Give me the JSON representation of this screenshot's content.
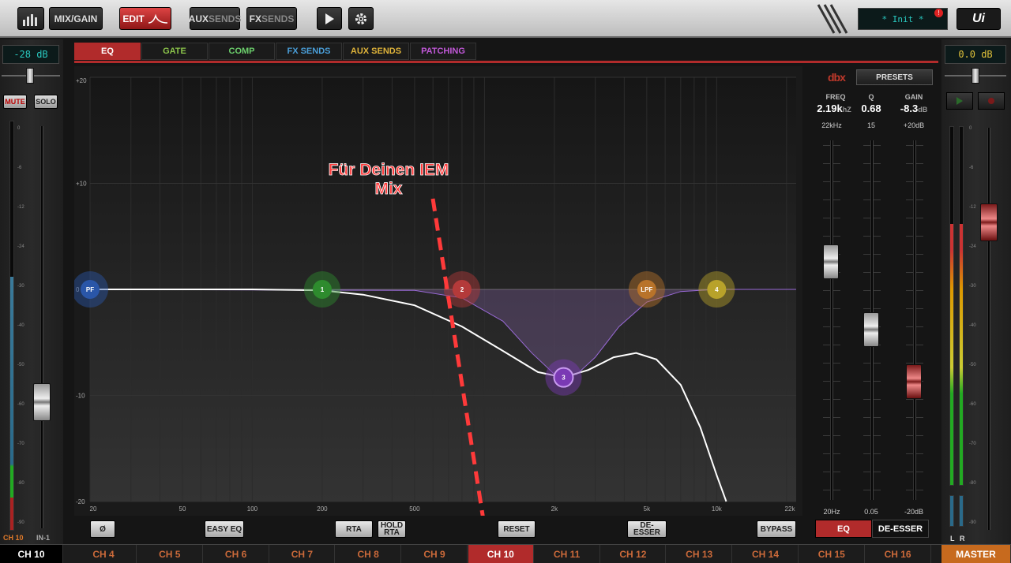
{
  "topbar": {
    "mix_gain": "MIX/GAIN",
    "edit": "EDIT",
    "aux_a": "AUX",
    "aux_b": "SENDS",
    "fx_a": "FX",
    "fx_b": "SENDS",
    "scene_display": "* Init *",
    "badge": "!",
    "logo": "Ui"
  },
  "left_strip": {
    "db": "-28 dB",
    "mute": "MUTE",
    "solo": "SOLO",
    "scale": [
      "0",
      "-6",
      "-12",
      "-24",
      "-30",
      "-40",
      "-50",
      "-60",
      "-70",
      "-80",
      "-90"
    ],
    "meter_scale": [
      "10",
      "15",
      "20"
    ],
    "label_left": "CH 10",
    "label_right": "IN-1"
  },
  "tabs": [
    {
      "label": "EQ",
      "color": "#ffffff"
    },
    {
      "label": "GATE",
      "color": "#8bc34a"
    },
    {
      "label": "COMP",
      "color": "#6ccf6c"
    },
    {
      "label": "FX SENDS",
      "color": "#4a9ed8"
    },
    {
      "label": "AUX SENDS",
      "color": "#e0b43a"
    },
    {
      "label": "PATCHING",
      "color": "#c158d8"
    }
  ],
  "graph": {
    "y_ticks": [
      "+20",
      "+10",
      "0",
      "-10",
      "-20"
    ],
    "x_ticks": [
      "20",
      "50",
      "100",
      "200",
      "500",
      "2k",
      "5k",
      "10k",
      "22k"
    ],
    "nodes": [
      {
        "label": "PF",
        "color": "#2a56a8"
      },
      {
        "label": "1",
        "color": "#2e8b2e"
      },
      {
        "label": "2",
        "color": "#b43a3a"
      },
      {
        "label": "3",
        "color": "#7a3ab4"
      },
      {
        "label": "LPF",
        "color": "#b8732a"
      },
      {
        "label": "4",
        "color": "#b8a22a"
      }
    ],
    "annotation": [
      "Für Deinen IEM",
      "Mix"
    ],
    "annotation_color": "#ff3a3a"
  },
  "chart_data": {
    "type": "line",
    "x_scale": "log",
    "x_range": [
      20,
      22000
    ],
    "y_range": [
      -20,
      20
    ],
    "y_unit": "dB",
    "bands": [
      {
        "label": "PF",
        "freq": 20,
        "gain": 0
      },
      {
        "label": "1",
        "freq": 200,
        "gain": 0
      },
      {
        "label": "2",
        "freq": 800,
        "gain": 0
      },
      {
        "label": "3",
        "freq": 2190,
        "gain": -8.3,
        "q": 0.68
      },
      {
        "label": "LPF",
        "freq": 5000,
        "gain": 0
      },
      {
        "label": "4",
        "freq": 10000,
        "gain": 0
      }
    ],
    "response": [
      {
        "x": 20,
        "y": 0
      },
      {
        "x": 100,
        "y": 0
      },
      {
        "x": 200,
        "y": -0.1
      },
      {
        "x": 300,
        "y": -0.5
      },
      {
        "x": 500,
        "y": -1.5
      },
      {
        "x": 800,
        "y": -3.5
      },
      {
        "x": 1200,
        "y": -5.8
      },
      {
        "x": 1700,
        "y": -7.8
      },
      {
        "x": 2190,
        "y": -8.3
      },
      {
        "x": 2800,
        "y": -7.6
      },
      {
        "x": 3600,
        "y": -6.4
      },
      {
        "x": 4500,
        "y": -6.0
      },
      {
        "x": 5500,
        "y": -6.6
      },
      {
        "x": 7000,
        "y": -9
      },
      {
        "x": 8500,
        "y": -13
      },
      {
        "x": 10000,
        "y": -17.5
      },
      {
        "x": 11000,
        "y": -20
      }
    ],
    "band3_curve": [
      {
        "x": 20,
        "y": 0
      },
      {
        "x": 500,
        "y": -0.1
      },
      {
        "x": 800,
        "y": -0.8
      },
      {
        "x": 1200,
        "y": -3
      },
      {
        "x": 1600,
        "y": -6
      },
      {
        "x": 2000,
        "y": -8
      },
      {
        "x": 2190,
        "y": -8.3
      },
      {
        "x": 2500,
        "y": -8
      },
      {
        "x": 3000,
        "y": -6.4
      },
      {
        "x": 3800,
        "y": -3.5
      },
      {
        "x": 5000,
        "y": -1.2
      },
      {
        "x": 7000,
        "y": -0.2
      },
      {
        "x": 10000,
        "y": 0
      },
      {
        "x": 22000,
        "y": 0
      }
    ]
  },
  "bottom": {
    "phase": "Ø",
    "easy_eq": "EASY EQ",
    "rta": "RTA",
    "hold_a": "HOLD",
    "hold_b": "RTA",
    "reset": "RESET",
    "de_esser": "DE-ESSER",
    "bypass": "BYPASS"
  },
  "right_panel": {
    "brand": "dbx",
    "presets": "PRESETS",
    "freq_label": "FREQ",
    "freq_value": "2.19k",
    "freq_unit": "hZ",
    "q_label": "Q",
    "q_value": "0.68",
    "gain_label": "GAIN",
    "gain_value": "-8.3",
    "gain_unit": "dB",
    "freq_max": "22kHz",
    "q_max": "15",
    "gain_max": "+20dB",
    "freq_min": "20Hz",
    "q_min": "0.05",
    "gain_min": "-20dB",
    "eq_btn": "EQ",
    "deesser_btn": "DE-ESSER"
  },
  "right_strip": {
    "db": "0.0 dB",
    "label_l": "L",
    "label_r": "R",
    "scale": [
      "0",
      "-6",
      "-12",
      "-24",
      "-30",
      "-40",
      "-50",
      "-60",
      "-70",
      "-80",
      "-90"
    ],
    "meter_scale": [
      "10",
      "15",
      "20"
    ]
  },
  "channels": [
    "CH 4",
    "CH 5",
    "CH 6",
    "CH 7",
    "CH 8",
    "CH 9",
    "CH 10",
    "CH 11",
    "CH 12",
    "CH 13",
    "CH 14",
    "CH 15",
    "CH 16"
  ],
  "channel_current": "CH 10",
  "master": "MASTER"
}
